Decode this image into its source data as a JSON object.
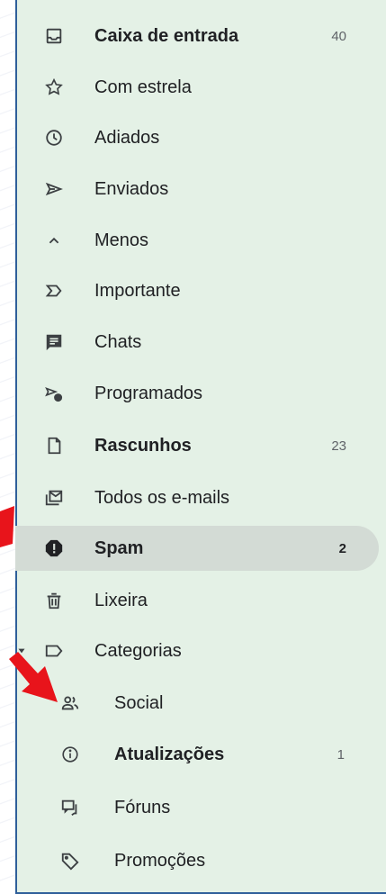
{
  "sidebar": {
    "items": [
      {
        "label": "Caixa de entrada",
        "count": "40",
        "icon": "inbox-icon"
      },
      {
        "label": "Com estrela",
        "icon": "star-icon"
      },
      {
        "label": "Adiados",
        "icon": "clock-icon"
      },
      {
        "label": "Enviados",
        "icon": "send-icon"
      },
      {
        "label": "Menos",
        "icon": "chevron-up-icon"
      },
      {
        "label": "Importante",
        "icon": "important-icon"
      },
      {
        "label": "Chats",
        "icon": "chat-icon"
      },
      {
        "label": "Programados",
        "icon": "scheduled-icon"
      },
      {
        "label": "Rascunhos",
        "count": "23",
        "icon": "draft-icon"
      },
      {
        "label": "Todos os e-mails",
        "icon": "all-mail-icon"
      },
      {
        "label": "Spam",
        "count": "2",
        "icon": "spam-icon"
      },
      {
        "label": "Lixeira",
        "icon": "trash-icon"
      },
      {
        "label": "Categorias",
        "icon": "label-icon"
      }
    ],
    "categories": [
      {
        "label": "Social",
        "icon": "people-icon"
      },
      {
        "label": "Atualizações",
        "count": "1",
        "icon": "info-icon"
      },
      {
        "label": "Fóruns",
        "icon": "forum-icon"
      },
      {
        "label": "Promoções",
        "icon": "tag-icon"
      }
    ]
  },
  "colors": {
    "panel_background": "#e4f1e6",
    "active_background": "#d3dbd5",
    "panel_border": "#2f5f9a",
    "annotation_arrow": "#e8141b"
  }
}
